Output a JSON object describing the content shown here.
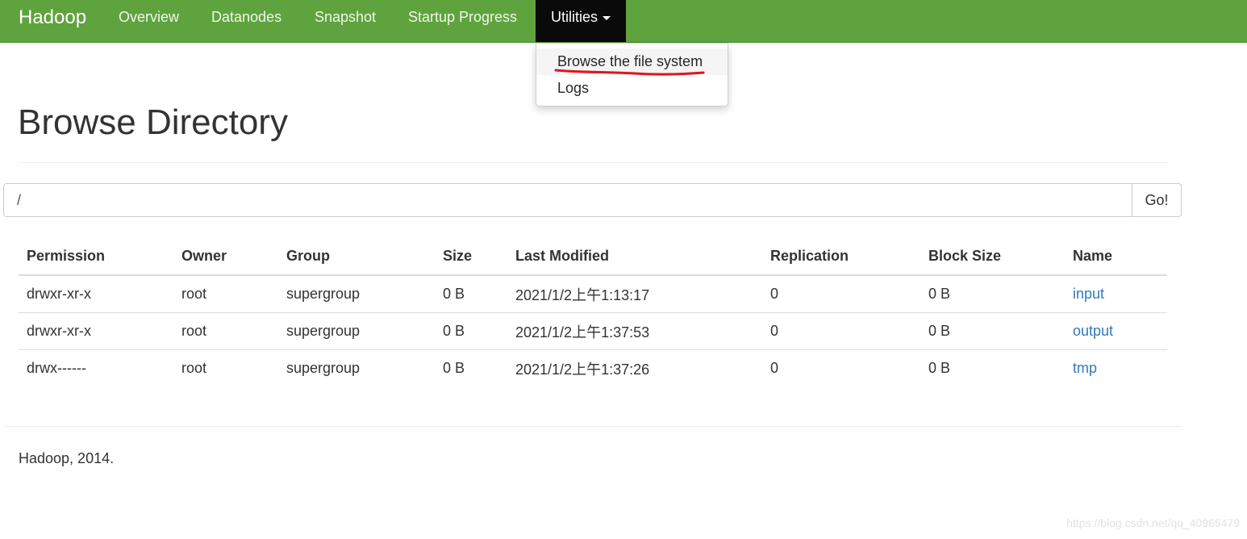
{
  "navbar": {
    "brand": "Hadoop",
    "items": [
      "Overview",
      "Datanodes",
      "Snapshot",
      "Startup Progress"
    ],
    "active": "Utilities",
    "bg_color": "#5fa33e"
  },
  "dropdown": {
    "items": [
      "Browse the file system",
      "Logs"
    ]
  },
  "page": {
    "title": "Browse Directory"
  },
  "path": {
    "value": "/",
    "go_label": "Go!"
  },
  "table": {
    "headers": [
      "Permission",
      "Owner",
      "Group",
      "Size",
      "Last Modified",
      "Replication",
      "Block Size",
      "Name"
    ],
    "rows": [
      [
        "drwxr-xr-x",
        "root",
        "supergroup",
        "0 B",
        "2021/1/2上午1:13:17",
        "0",
        "0 B",
        "input"
      ],
      [
        "drwxr-xr-x",
        "root",
        "supergroup",
        "0 B",
        "2021/1/2上午1:37:53",
        "0",
        "0 B",
        "output"
      ],
      [
        "drwx------",
        "root",
        "supergroup",
        "0 B",
        "2021/1/2上午1:37:26",
        "0",
        "0 B",
        "tmp"
      ]
    ]
  },
  "footer": {
    "text": "Hadoop, 2014."
  },
  "watermark": "https://blog.csdn.net/qq_40965479"
}
